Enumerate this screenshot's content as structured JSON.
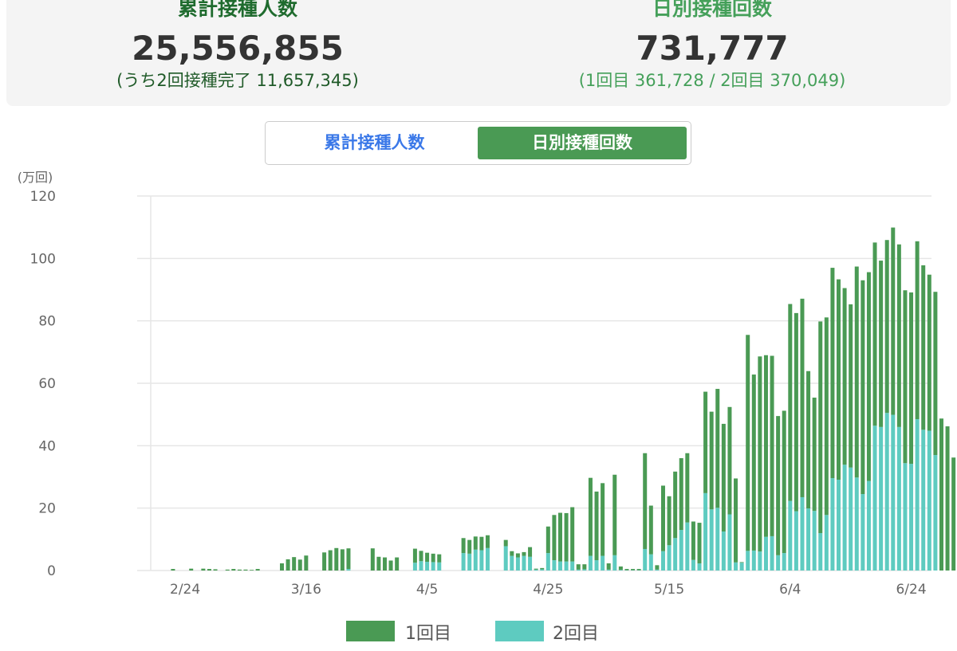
{
  "stats": {
    "cumulative": {
      "label": "累計接種人数",
      "value": "25,556,855",
      "sub": "(うち2回接種完了 11,657,345)"
    },
    "daily": {
      "label": "日別接種回数",
      "value": "731,777",
      "sub": "(1回目 361,728 / 2回目 370,049)"
    }
  },
  "toggle": {
    "cumulative_label": "累計接種人数",
    "daily_label": "日別接種回数",
    "active": "daily"
  },
  "colors": {
    "dose1": "#4a9a54",
    "dose2": "#5ecbc0",
    "grid": "#e6e6e6",
    "axis_text": "#666666",
    "active_tab": "#4a9a54",
    "inactive_tab_text": "#3a78e8"
  },
  "chart_data": {
    "type": "bar",
    "stacked": true,
    "unit_label": "(万回)",
    "ylim": [
      0,
      120
    ],
    "yticks": [
      0,
      20,
      40,
      60,
      80,
      100,
      120
    ],
    "x_tick_labels": [
      {
        "index": 7,
        "label": "2/24"
      },
      {
        "index": 27,
        "label": "3/16"
      },
      {
        "index": 47,
        "label": "4/5"
      },
      {
        "index": 67,
        "label": "4/25"
      },
      {
        "index": 87,
        "label": "5/15"
      },
      {
        "index": 107,
        "label": "6/4"
      },
      {
        "index": 127,
        "label": "6/24"
      }
    ],
    "legend": [
      "1回目",
      "2回目"
    ],
    "series": [
      {
        "name": "1回目",
        "values": [
          0,
          0,
          0,
          0,
          0,
          0.5,
          0,
          0,
          0.6,
          0,
          0.6,
          0.5,
          0.4,
          0,
          0.3,
          0.5,
          0.3,
          0.3,
          0.2,
          0.5,
          0,
          0,
          0,
          2.3,
          3.6,
          4.3,
          3.5,
          4.8,
          0,
          0,
          5.8,
          6.5,
          7.2,
          6.8,
          6.6,
          0,
          0,
          0,
          7.1,
          4.4,
          4.2,
          3.2,
          4.2,
          0,
          0,
          4.5,
          3.3,
          2.9,
          2.7,
          2.6,
          0,
          0,
          0,
          4.8,
          4.4,
          4.2,
          4.3,
          4.1,
          0,
          0,
          2.0,
          1.5,
          1.3,
          1.2,
          3.1,
          0.3,
          0.4,
          8.5,
          14.5,
          15.6,
          15.5,
          17.4,
          1.7,
          1.6,
          25.0,
          22.0,
          23.3,
          2.0,
          25.8,
          1.1,
          0.4,
          0.4,
          0.4,
          30.7,
          15.6,
          1.4,
          21.0,
          15.7,
          21.3,
          23.0,
          22.2,
          12.3,
          13.0,
          32.5,
          31.3,
          38.1,
          34.5,
          34.4,
          26.9,
          0.2,
          69.2,
          56.4,
          62.5,
          58.2,
          57.8,
          44.6,
          45.6,
          63.1,
          63.5,
          63.6,
          44.0,
          36.3,
          67.8,
          63.3,
          67.4,
          64.2,
          56.6,
          52.3,
          67.6,
          68.5,
          66.9,
          58.7,
          53.3,
          55.4,
          60.0,
          58.5,
          55.4,
          54.9,
          57.0,
          52.7,
          50.0,
          52.3,
          48.7,
          46.2,
          36.2
        ]
      },
      {
        "name": "2回目",
        "values": [
          0,
          0,
          0,
          0,
          0,
          0,
          0,
          0,
          0,
          0,
          0,
          0,
          0,
          0,
          0,
          0,
          0,
          0,
          0,
          0,
          0,
          0,
          0,
          0,
          0,
          0,
          0,
          0,
          0,
          0,
          0,
          0,
          0,
          0,
          0.5,
          0,
          0,
          0,
          0,
          0,
          0,
          0,
          0,
          0,
          0,
          2.5,
          3.0,
          2.8,
          2.7,
          2.6,
          0,
          0,
          0,
          5.6,
          5.4,
          6.7,
          6.5,
          7.2,
          0,
          0,
          7.8,
          4.7,
          4.2,
          4.7,
          4.4,
          0.3,
          0.4,
          5.6,
          3.3,
          2.9,
          2.9,
          2.9,
          0.3,
          0.4,
          4.7,
          3.3,
          4.7,
          0.3,
          4.9,
          0.2,
          0.1,
          0.1,
          0.1,
          6.9,
          5.2,
          0.3,
          6.2,
          8.1,
          10.4,
          13.0,
          15.4,
          3.4,
          2.3,
          24.8,
          19.6,
          20.1,
          12.5,
          18.0,
          2.6,
          2.5,
          6.3,
          6.4,
          6.1,
          10.8,
          11.0,
          4.9,
          5.6,
          22.3,
          19.0,
          23.5,
          19.9,
          19.1,
          12.0,
          17.8,
          29.6,
          29.1,
          33.9,
          33.0,
          29.8,
          24.5,
          28.7,
          46.4,
          46.0,
          50.5,
          49.9,
          46.0,
          34.4,
          34.2,
          48.5,
          45.1,
          44.8,
          37.0
        ]
      }
    ]
  }
}
